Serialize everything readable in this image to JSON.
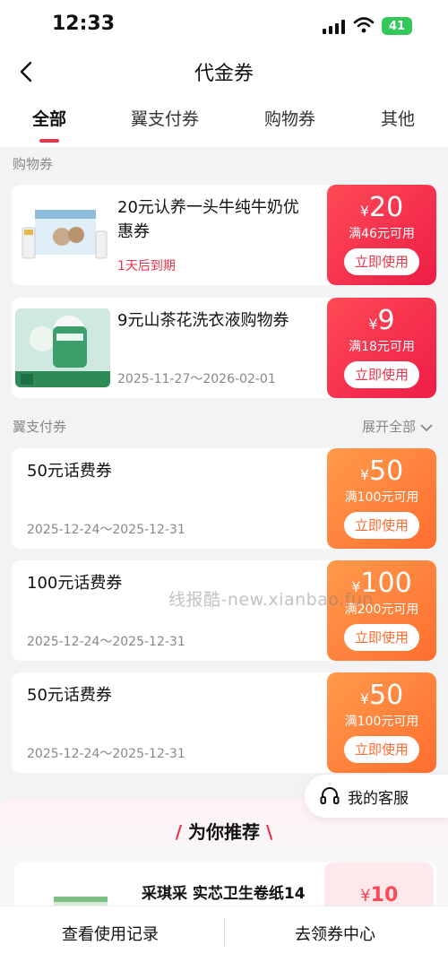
{
  "status": {
    "time": "12:33",
    "battery": "41"
  },
  "header": {
    "title": "代金券"
  },
  "tabs": [
    {
      "label": "全部"
    },
    {
      "label": "翼支付券"
    },
    {
      "label": "购物券"
    },
    {
      "label": "其他"
    }
  ],
  "sections": {
    "shopping": {
      "label": "购物券"
    },
    "pay": {
      "label": "翼支付券",
      "expand": "展开全部"
    }
  },
  "shopping_coupons": [
    {
      "name_line1": "20元认养一头牛纯牛奶优",
      "name_line2": "惠券",
      "note": "1天后到期",
      "yen": "¥",
      "amount": "20",
      "condition": "满46元可用",
      "button": "立即使用"
    },
    {
      "name_line1": "9元山茶花洗衣液购物券",
      "note": "2025-11-27～2026-02-01",
      "yen": "¥",
      "amount": "9",
      "condition": "满18元可用",
      "button": "立即使用"
    }
  ],
  "pay_coupons": [
    {
      "name": "50元话费券",
      "date": "2025-12-24～2025-12-31",
      "yen": "¥",
      "amount": "50",
      "condition": "满100元可用",
      "button": "立即使用"
    },
    {
      "name": "100元话费券",
      "date": "2025-12-24～2025-12-31",
      "yen": "¥",
      "amount": "100",
      "condition": "满200元可用",
      "button": "立即使用"
    },
    {
      "name": "50元话费券",
      "date": "2025-12-24～2025-12-31",
      "yen": "¥",
      "amount": "50",
      "condition": "满100元可用",
      "button": "立即使用"
    }
  ],
  "watermark": "线报酷-new.xianbao.fun",
  "service": {
    "label": "我的客服"
  },
  "recommend": {
    "title": "为你推荐",
    "item_name": "采琪采 实芯卫生卷纸14",
    "price_yen": "¥",
    "price": "10"
  },
  "bottom": {
    "left": "查看使用记录",
    "right": "去领券中心"
  },
  "colors": {
    "accent": "#e8334a",
    "orange": "#ff6e2f",
    "red": "#ee1d47"
  }
}
